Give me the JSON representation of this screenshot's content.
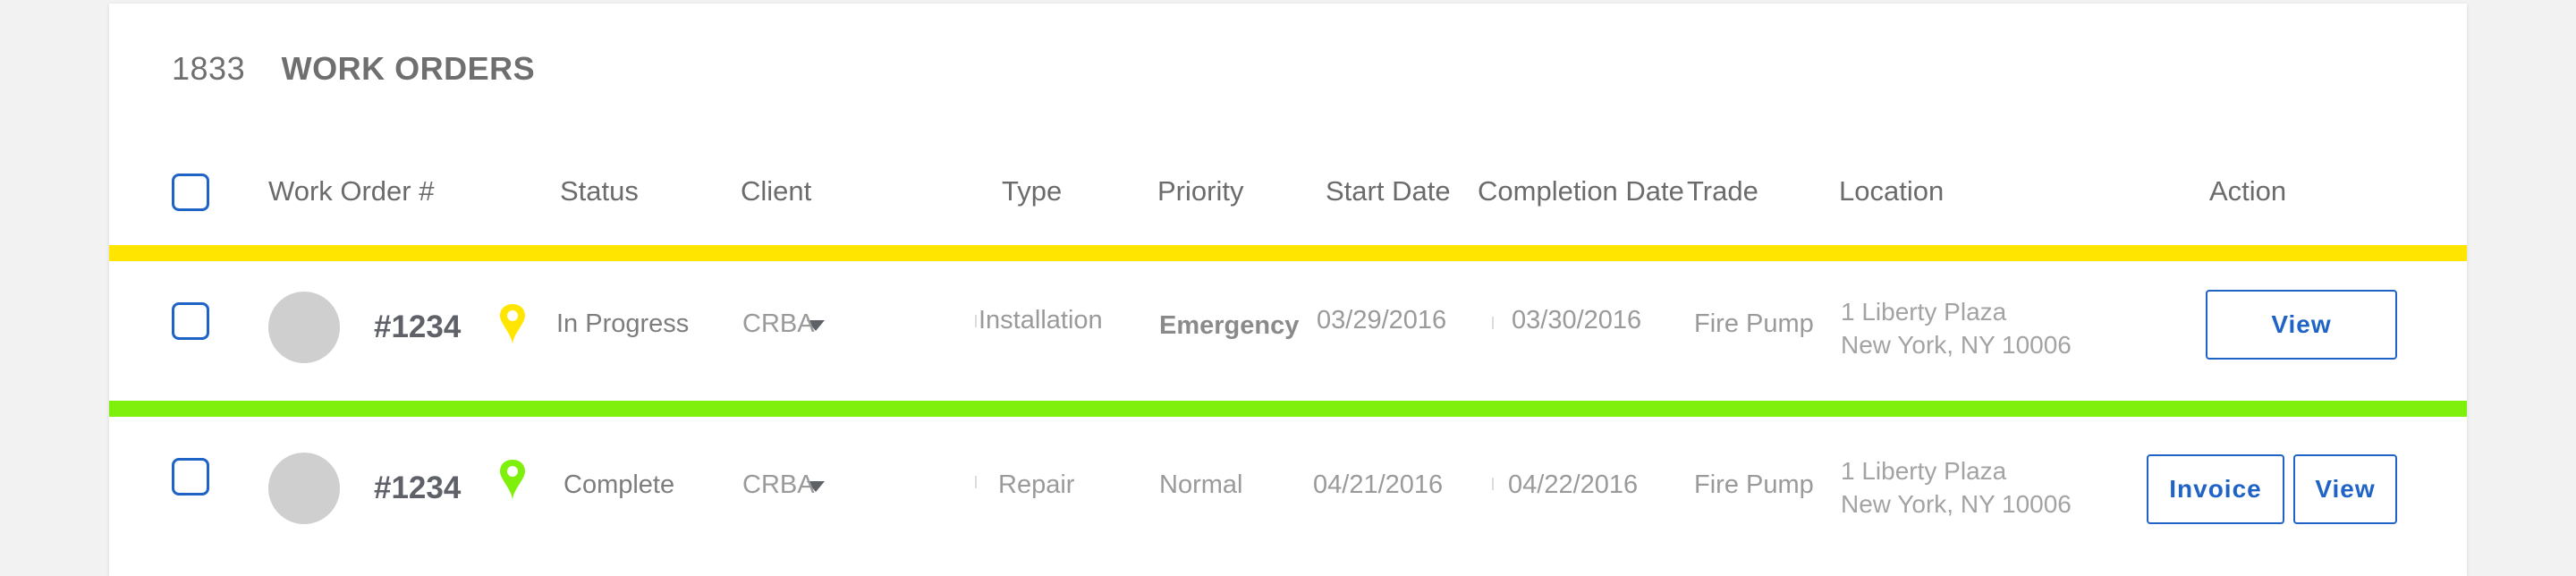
{
  "header": {
    "count": "1833",
    "title": "WORK ORDERS"
  },
  "columns": {
    "work_order": "Work Order #",
    "status": "Status",
    "client": "Client",
    "type": "Type",
    "priority": "Priority",
    "start_date": "Start Date",
    "completion_date": "Completion Date",
    "trade": "Trade",
    "location": "Location",
    "action": "Action"
  },
  "colors": {
    "accent": "#1f63c6",
    "in_progress": "#ffe500",
    "complete": "#7fef0c"
  },
  "rows": [
    {
      "number": "#1234",
      "status_icon": "map-pin-icon",
      "status": "In Progress",
      "client": "CRBA",
      "type": "Installation",
      "priority": "Emergency",
      "start_date": "03/29/2016",
      "completion_date": "03/30/2016",
      "trade": "Fire Pump",
      "location_line1": "1 Liberty Plaza",
      "location_line2": "New York, NY 10006",
      "view_label": "View"
    },
    {
      "number": "#1234",
      "status_icon": "map-pin-icon",
      "status": "Complete",
      "client": "CRBA",
      "type": "Repair",
      "priority": "Normal",
      "start_date": "04/21/2016",
      "completion_date": "04/22/2016",
      "trade": "Fire Pump",
      "location_line1": "1 Liberty Plaza",
      "location_line2": "New York, NY 10006",
      "invoice_label": "Invoice",
      "view_label": "View"
    }
  ]
}
